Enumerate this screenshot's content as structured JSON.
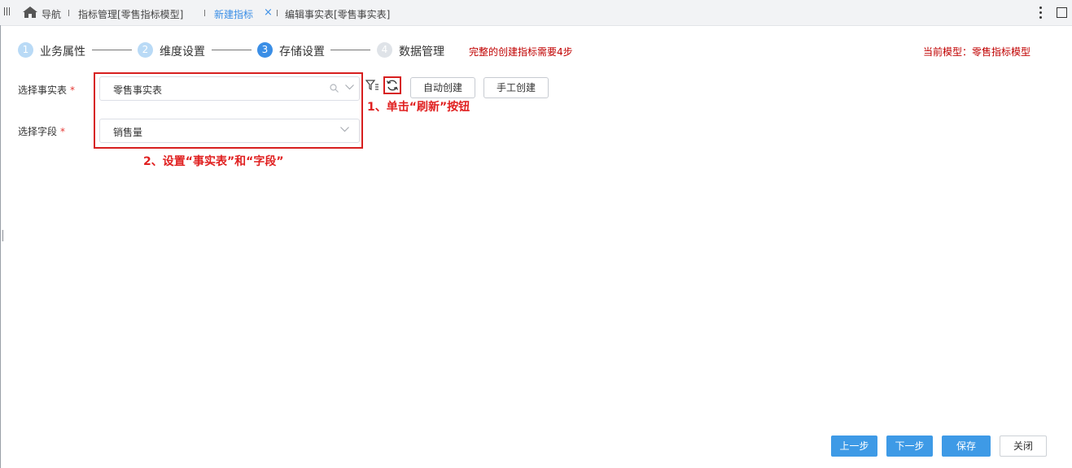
{
  "tabbar": {
    "nav_label": "导航",
    "tabs": [
      {
        "label": "指标管理[零售指标模型]",
        "active": false
      },
      {
        "label": "新建指标",
        "active": true,
        "closable": true
      },
      {
        "label": "编辑事实表[零售事实表]",
        "active": false
      }
    ],
    "close_glyph": "×"
  },
  "steps": [
    {
      "number": "1",
      "label": "业务属性",
      "state": "done"
    },
    {
      "number": "2",
      "label": "维度设置",
      "state": "done"
    },
    {
      "number": "3",
      "label": "存储设置",
      "state": "current"
    },
    {
      "number": "4",
      "label": "数据管理",
      "state": "pending"
    }
  ],
  "steps_hint": "完整的创建指标需要4步",
  "current_model": "当前模型：零售指标模型",
  "form": {
    "fact_table": {
      "label": "选择事实表",
      "required_mark": "*",
      "value": "零售事实表"
    },
    "field": {
      "label": "选择字段",
      "required_mark": "*",
      "value": "销售量"
    }
  },
  "buttons": {
    "auto_create": "自动创建",
    "manual_create": "手工创建",
    "prev": "上一步",
    "next": "下一步",
    "save": "保存",
    "close": "关闭"
  },
  "annotations": {
    "refresh_hint": "1、单击“刷新”按钮",
    "set_hint": "2、设置“事实表”和“字段”"
  },
  "colors": {
    "primary": "#3e9ae6",
    "step_done": "#b9daf6",
    "step_current": "#3a8ee6",
    "step_pending": "#dfe3e8",
    "annotation_red": "#e02020",
    "hint_red": "#c00000"
  },
  "icons": [
    "menu-icon",
    "home-icon",
    "close-icon",
    "more-icon",
    "maximize-icon",
    "search-icon",
    "chevron-down-icon",
    "filter-icon",
    "refresh-icon"
  ]
}
